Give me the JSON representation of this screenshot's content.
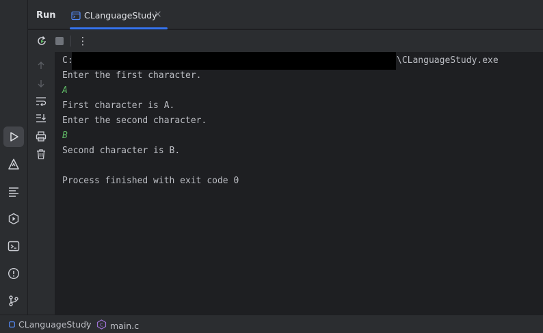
{
  "header": {
    "run_label": "Run",
    "tab_label": "CLanguageStudy",
    "tab_close": "×"
  },
  "toolbar": {
    "more_label": "⋮"
  },
  "console": {
    "path_prefix": "C:",
    "path_suffix": "\\CLanguageStudy.exe",
    "lines": [
      {
        "text": "Enter the first character.",
        "kind": "output"
      },
      {
        "text": "A",
        "kind": "input"
      },
      {
        "text": "First character is A.",
        "kind": "output"
      },
      {
        "text": "Enter the second character.",
        "kind": "output"
      },
      {
        "text": "B",
        "kind": "input"
      },
      {
        "text": "Second character is B.",
        "kind": "output"
      },
      {
        "text": "",
        "kind": "output"
      },
      {
        "text": "Process finished with exit code 0",
        "kind": "output"
      }
    ]
  },
  "statusbar": {
    "project": "CLanguageStudy",
    "separator": "›",
    "file": "main.c"
  },
  "colors": {
    "accent": "#3574f0",
    "input_text": "#5fb865",
    "run_icon_green": "#5fb865"
  },
  "icons": {
    "left_strip": [
      "run-icon",
      "build-icon",
      "structure-icon",
      "services-icon",
      "terminal-icon",
      "problems-icon",
      "git-icon"
    ],
    "toolbar": [
      "rerun-icon",
      "stop-icon",
      "more-icon"
    ],
    "gutter": [
      "up-arrow-icon",
      "down-arrow-icon",
      "soft-wrap-icon",
      "scroll-to-end-icon",
      "print-icon",
      "trash-icon"
    ]
  }
}
